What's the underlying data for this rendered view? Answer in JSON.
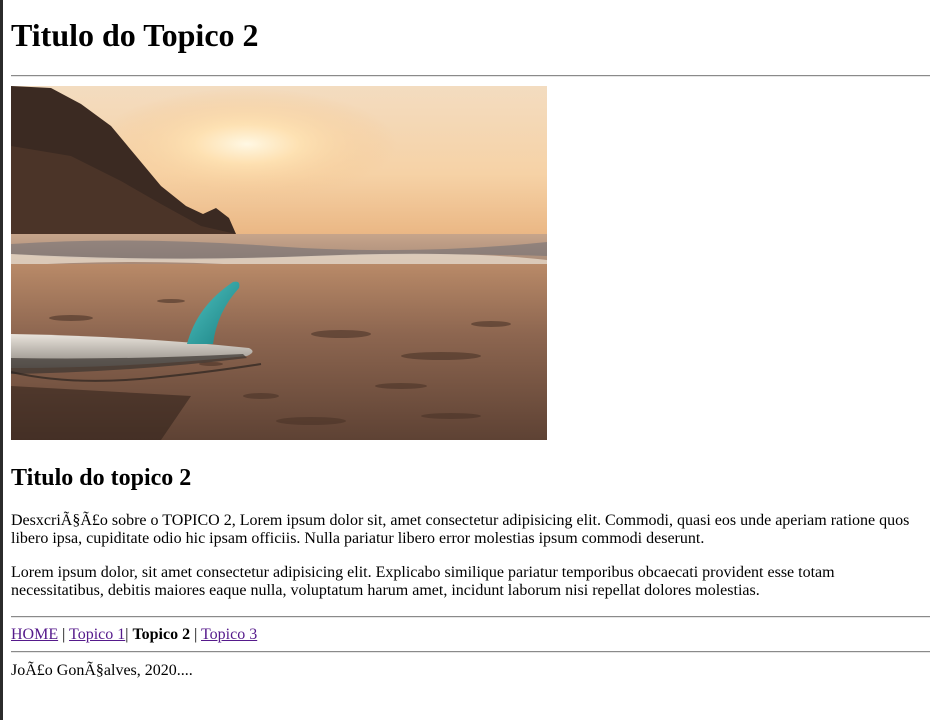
{
  "page": {
    "title": "Titulo do Topico 2"
  },
  "hero_image": {
    "alt": "surfboard on beach at sunset"
  },
  "article": {
    "heading": "Titulo do topico 2",
    "paragraph1": "DesxcriÃ§Ã£o sobre o TOPICO 2, Lorem ipsum dolor sit, amet consectetur adipisicing elit. Commodi, quasi eos unde aperiam ratione quos libero ipsa, cupiditate odio hic ipsam officiis. Nulla pariatur libero error molestias ipsum commodi deserunt.",
    "paragraph2": "Lorem ipsum dolor, sit amet consectetur adipisicing elit. Explicabo similique pariatur temporibus obcaecati provident esse totam necessitatibus, debitis maiores eaque nulla, voluptatum harum amet, incidunt laborum nisi repellat dolores molestias."
  },
  "nav": {
    "home": "HOME",
    "topico1": "Topico 1",
    "topico2": "Topico 2",
    "topico3": "Topico 3",
    "sep": " | ",
    "sep_tight": "| "
  },
  "footer": {
    "text": "JoÃ£o GonÃ§alves, 2020...."
  },
  "colors": {
    "link_visited": "#551a8b",
    "rule": "#8a8a8a"
  }
}
